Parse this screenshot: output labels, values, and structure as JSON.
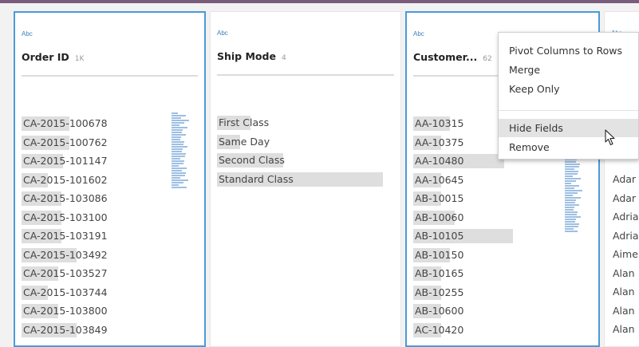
{
  "columns": [
    {
      "type_label": "Abc",
      "title": "Order ID",
      "count": "1K",
      "values": [
        {
          "text": "CA-2015-100678",
          "highlight": 0.29
        },
        {
          "text": "CA-2015-100762",
          "highlight": 0.29
        },
        {
          "text": "CA-2015-101147",
          "highlight": 0.25
        },
        {
          "text": "CA-2015-101602",
          "highlight": 0.16
        },
        {
          "text": "CA-2015-103086",
          "highlight": 0.24
        },
        {
          "text": "CA-2015-103100",
          "highlight": 0.24
        },
        {
          "text": "CA-2015-103191",
          "highlight": 0.24
        },
        {
          "text": "CA-2015-103492",
          "highlight": 0.33
        },
        {
          "text": "CA-2015-103527",
          "highlight": 0.22
        },
        {
          "text": "CA-2015-103744",
          "highlight": 0.16
        },
        {
          "text": "CA-2015-103800",
          "highlight": 0.22
        },
        {
          "text": "CA-2015-103849",
          "highlight": 0.33
        }
      ]
    },
    {
      "type_label": "Abc",
      "title": "Ship Mode",
      "count": "4",
      "values": [
        {
          "text": "First Class",
          "highlight": 0.2
        },
        {
          "text": "Same Day",
          "highlight": 0.14
        },
        {
          "text": "Second Class",
          "highlight": 0.4
        },
        {
          "text": "Standard Class",
          "highlight": 1.0
        }
      ]
    },
    {
      "type_label": "Abc",
      "title": "Customer...",
      "count": "62",
      "values": [
        {
          "text": "AA-10315",
          "highlight": 0.22
        },
        {
          "text": "AA-10375",
          "highlight": 0.17
        },
        {
          "text": "AA-10480",
          "highlight": 0.55
        },
        {
          "text": "AA-10645",
          "highlight": 0.17
        },
        {
          "text": "AB-10015",
          "highlight": 0.17
        },
        {
          "text": "AB-10060",
          "highlight": 0.25
        },
        {
          "text": "AB-10105",
          "highlight": 0.6
        },
        {
          "text": "AB-10150",
          "highlight": 0.22
        },
        {
          "text": "AB-10165",
          "highlight": 0.17
        },
        {
          "text": "AB-10255",
          "highlight": 0.17
        },
        {
          "text": "AB-10600",
          "highlight": 0.17
        },
        {
          "text": "AC-10420",
          "highlight": 0.17
        }
      ]
    },
    {
      "type_label": "Abc",
      "values": [
        {
          "text": "Adar",
          "highlight": 0
        },
        {
          "text": "Adar",
          "highlight": 0
        },
        {
          "text": "Adria",
          "highlight": 0
        },
        {
          "text": "Adria",
          "highlight": 0
        },
        {
          "text": "Aime",
          "highlight": 0
        },
        {
          "text": "Alan",
          "highlight": 0
        },
        {
          "text": "Alan",
          "highlight": 0
        },
        {
          "text": "Alan",
          "highlight": 0
        },
        {
          "text": "Alan",
          "highlight": 0
        }
      ]
    }
  ],
  "context_menu": {
    "items": [
      {
        "label": "Pivot Columns to Rows",
        "highlighted": false
      },
      {
        "label": "Merge",
        "highlighted": false
      },
      {
        "label": "Keep Only",
        "highlighted": false
      },
      {
        "label": "Hide Fields",
        "highlighted": true
      },
      {
        "label": "Remove",
        "highlighted": false
      }
    ]
  },
  "colors": {
    "selection_border": "#4a9bd6",
    "type_icon": "#3a7fc1",
    "header_bar": "#7a5c7d",
    "value_highlight": "#dedede",
    "sparkline": "#9dbfe3"
  }
}
